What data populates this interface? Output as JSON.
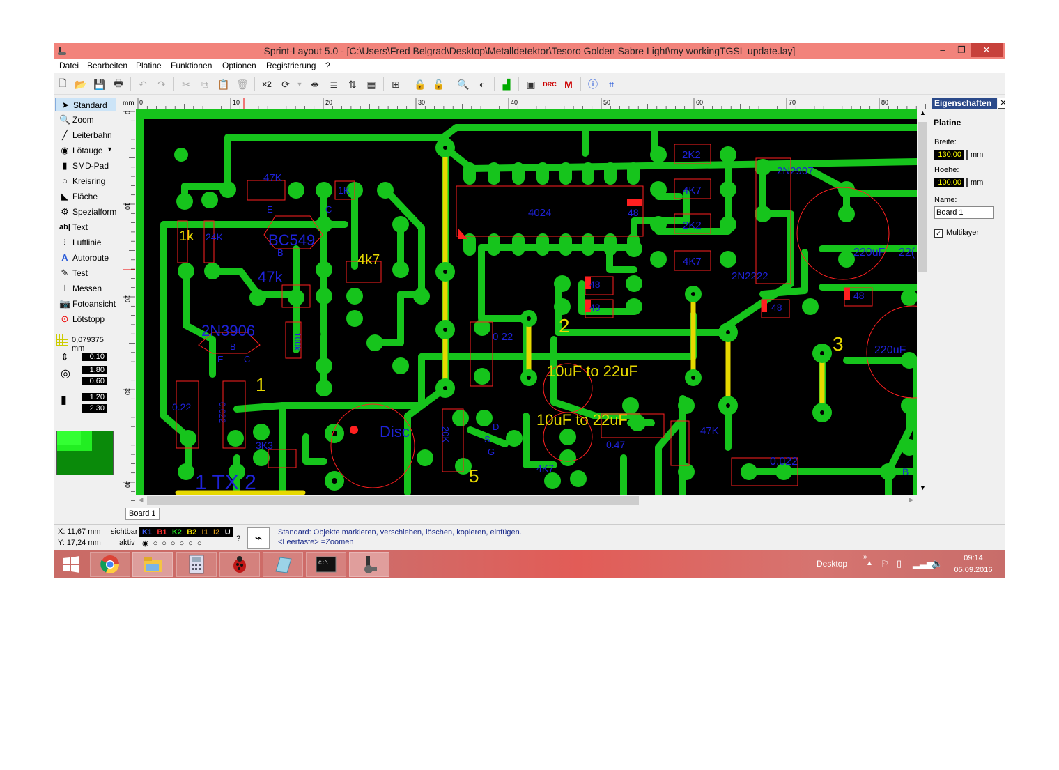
{
  "window": {
    "title": "Sprint-Layout 5.0 - [C:\\Users\\Fred Belgrad\\Desktop\\Metalldetektor\\Tesoro Golden Sabre Light\\my workingTGSL update.lay]",
    "controls": {
      "minimize": "–",
      "restore": "❐",
      "close": "✕"
    }
  },
  "menu": [
    "Datei",
    "Bearbeiten",
    "Platine",
    "Funktionen",
    "Optionen",
    "Registrierung",
    "?"
  ],
  "tools": [
    {
      "label": "Standard",
      "icon": "cursor-icon"
    },
    {
      "label": "Zoom",
      "icon": "zoom-icon"
    },
    {
      "label": "Leiterbahn",
      "icon": "track-icon"
    },
    {
      "label": "Lötauge",
      "icon": "pad-icon"
    },
    {
      "label": "SMD-Pad",
      "icon": "smd-pad-icon"
    },
    {
      "label": "Kreisring",
      "icon": "circle-icon"
    },
    {
      "label": "Fläche",
      "icon": "area-icon"
    },
    {
      "label": "Spezialform",
      "icon": "special-shape-icon"
    },
    {
      "label": "Text",
      "icon": "text-icon"
    },
    {
      "label": "Luftlinie",
      "icon": "airwire-icon"
    },
    {
      "label": "Autoroute",
      "icon": "autoroute-icon"
    },
    {
      "label": "Test",
      "icon": "test-icon"
    },
    {
      "label": "Messen",
      "icon": "measure-icon"
    },
    {
      "label": "Fotoansicht",
      "icon": "photo-view-icon"
    },
    {
      "label": "Lötstopp",
      "icon": "solder-stop-icon"
    }
  ],
  "params": {
    "grid": "0,079375 mm",
    "track_width": "0.10",
    "pad_outer": "1.80",
    "pad_inner": "0.60",
    "smd_w": "1.20",
    "smd_h": "2.30"
  },
  "ruler": {
    "unit": "mm",
    "h_labels": [
      "0",
      "10",
      "20",
      "30",
      "40",
      "50",
      "60",
      "70",
      "80"
    ],
    "v_labels": [
      "0",
      "10",
      "20",
      "30",
      "40"
    ]
  },
  "board_labels": {
    "r47k": "47K",
    "r1k_top": "1K",
    "bc549": "BC549",
    "e": "E",
    "c": "C",
    "b": "B",
    "r1k": "1k",
    "r24k": "24K",
    "r4k7": "4k7",
    "r47k_big": "47k",
    "q2n3906": "2N3906",
    "r100k": "100k",
    "one": "1",
    "c022a": "0.22",
    "c0022": "0.022",
    "r3k3": "3K3",
    "tx": "1 TX 2",
    "disc": "Disc",
    "r20k": "20K",
    "s": "S",
    "g": "G",
    "d": "D",
    "five": "5",
    "c022b": "0 22",
    "two": "2",
    "cap10a": "10uF to 22uF",
    "cap10b": "10uF to 22uF",
    "ic4024": "4024",
    "r48a": "48",
    "r48b": "48",
    "r48c": "48",
    "r48d": "48",
    "r48e": "48",
    "r2k2a": "2K2",
    "r4k7a": "4K7",
    "r2k2b": "2K2",
    "r4k7b": "4K7",
    "q2n2907": "2N2907",
    "q2n2222": "2N2222",
    "cap220a": "220uF",
    "cap220b": "220uF",
    "cap220c": "22(",
    "three": "3",
    "r47kb": "47K",
    "c047": "0.47",
    "r4k7c": "4K7",
    "c0022b": "0.022",
    "bb": "B"
  },
  "tab": "Board 1",
  "properties": {
    "header": "Eigenschaften",
    "section": "Platine",
    "width_label": "Breite:",
    "width_value": "130.00",
    "height_label": "Hoehe:",
    "height_value": "100.00",
    "unit": "mm",
    "name_label": "Name:",
    "name_value": "Board 1",
    "multilayer_label": "Multilayer"
  },
  "status": {
    "x": "X:  11,67 mm",
    "y": "Y:  17,24 mm",
    "sichtbar": "sichtbar",
    "aktiv": "aktiv",
    "layers": [
      {
        "name": "K1",
        "color": "#4060ff"
      },
      {
        "name": "B1",
        "color": "#ff3030"
      },
      {
        "name": "K2",
        "color": "#22dd22"
      },
      {
        "name": "B2",
        "color": "#f0e000"
      },
      {
        "name": "I1",
        "color": "#e0a020"
      },
      {
        "name": "I2",
        "color": "#e0a020"
      },
      {
        "name": "U",
        "color": "#ffffff"
      }
    ],
    "q": "?",
    "msg1": "Standard: Objekte markieren, verschieben, löschen, kopieren, einfügen.",
    "msg2": "<Leertaste> =Zoomen"
  },
  "taskbar": {
    "desktop": "Desktop",
    "time": "09:14",
    "date": "05.09.2016",
    "apps": [
      "start-icon",
      "chrome-icon",
      "file-explorer-icon",
      "calculator-icon",
      "bug-app-icon",
      "notes-app-icon",
      "cmd-icon",
      "sprint-layout-icon"
    ]
  },
  "colors": {
    "copper": "#16c41c",
    "yellow": "#e6d800",
    "blue": "#1e22d8",
    "red": "#ff2020",
    "titlebar": "#f2837b"
  }
}
